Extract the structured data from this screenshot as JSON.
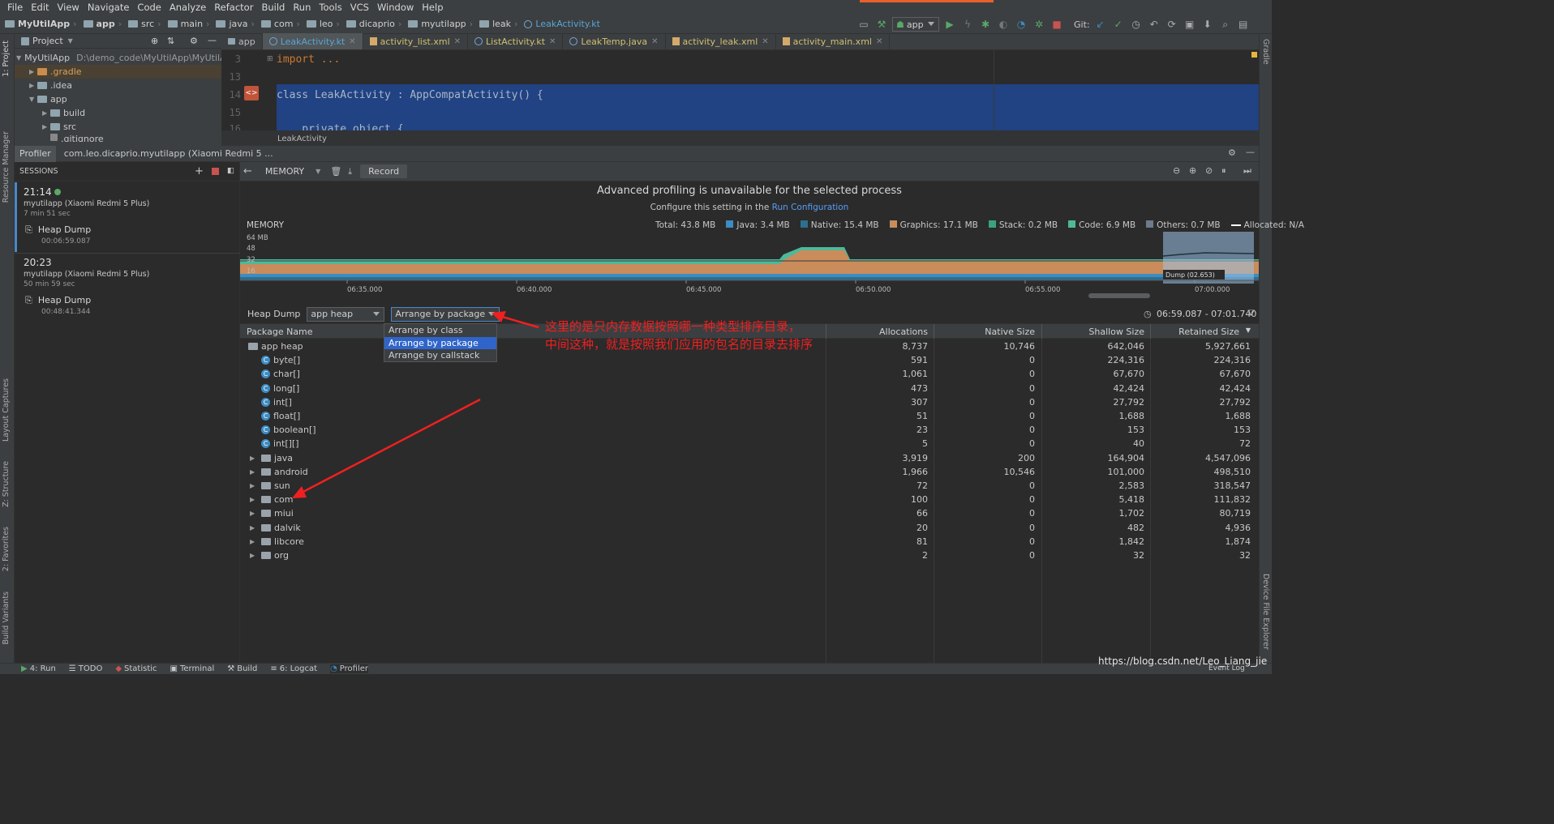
{
  "menu": [
    "File",
    "Edit",
    "View",
    "Navigate",
    "Code",
    "Analyze",
    "Refactor",
    "Build",
    "Run",
    "Tools",
    "VCS",
    "Window",
    "Help"
  ],
  "breadcrumbs": [
    "MyUtilApp",
    "app",
    "src",
    "main",
    "java",
    "com",
    "leo",
    "dicaprio",
    "myutilapp",
    "leak",
    "LeakActivity.kt"
  ],
  "toolbar": {
    "run_config": "app",
    "git_label": "Git:"
  },
  "project_panel": {
    "title": "Project",
    "tree": [
      {
        "label": "MyUtilApp",
        "path": "D:\\demo_code\\MyUtilApp\\MyUtilA",
        "depth": 0,
        "expanded": true
      },
      {
        "label": ".gradle",
        "depth": 1,
        "expanded": false
      },
      {
        "label": ".idea",
        "depth": 1,
        "expanded": false
      },
      {
        "label": "app",
        "depth": 1,
        "expanded": true
      },
      {
        "label": "build",
        "depth": 2,
        "expanded": false
      },
      {
        "label": "src",
        "depth": 2,
        "expanded": false
      },
      {
        "label": ".gitignore",
        "depth": 2
      }
    ]
  },
  "left_strip": [
    "1: Project",
    "Resource Manager",
    "Layout Captures",
    "Z: Structure",
    "2: Favorites",
    "Build Variants"
  ],
  "right_strip": [
    "Gradle",
    "Device File Explorer"
  ],
  "editor_tabs": [
    {
      "label": "app",
      "type": "folder"
    },
    {
      "label": "LeakActivity.kt",
      "type": "kt",
      "active": true
    },
    {
      "label": "activity_list.xml",
      "type": "xml"
    },
    {
      "label": "ListActivity.kt",
      "type": "kt"
    },
    {
      "label": "LeakTemp.java",
      "type": "java"
    },
    {
      "label": "activity_leak.xml",
      "type": "xml"
    },
    {
      "label": "activity_main.xml",
      "type": "xml"
    }
  ],
  "editor": {
    "lines": [
      {
        "num": "3",
        "text": "import ..."
      },
      {
        "num": "13",
        "text": ""
      },
      {
        "num": "14",
        "text": "class LeakActivity : AppCompatActivity() {"
      },
      {
        "num": "15",
        "text": ""
      },
      {
        "num": "16",
        "text": "    private object {"
      }
    ],
    "breadcrumb": "LeakActivity"
  },
  "profiler_header": {
    "tab": "Profiler",
    "process": "com.leo.dicaprio.myutilapp (Xiaomi Redmi 5 ..."
  },
  "sessions": {
    "title": "SESSIONS",
    "items": [
      {
        "time": "21:14",
        "device": "myutilapp (Xiaomi Redmi 5 Plus)",
        "duration": "7 min 51 sec",
        "dump": "Heap Dump",
        "dump_time": "00:06:59.087"
      },
      {
        "time": "20:23",
        "device": "myutilapp (Xiaomi Redmi 5 Plus)",
        "duration": "50 min 59 sec",
        "dump": "Heap Dump",
        "dump_time": "00:48:41.344"
      }
    ]
  },
  "memory_toolbar": {
    "mode": "MEMORY",
    "record": "Record"
  },
  "notice": {
    "title": "Advanced profiling is unavailable for the selected process",
    "sub": "Configure this setting in the ",
    "link": "Run Configuration"
  },
  "memory_chart": {
    "label": "MEMORY",
    "legend": [
      {
        "name": "Total: 43.8 MB",
        "color": ""
      },
      {
        "name": "Java: 3.4 MB",
        "color": "#3d8cc2"
      },
      {
        "name": "Native: 15.4 MB",
        "color": "#2e6e8e"
      },
      {
        "name": "Graphics: 17.1 MB",
        "color": "#c98c5a"
      },
      {
        "name": "Stack: 0.2 MB",
        "color": "#3aa37c"
      },
      {
        "name": "Code: 6.9 MB",
        "color": "#4fb89a"
      },
      {
        "name": "Others: 0.7 MB",
        "color": "#6d7c8a"
      },
      {
        "name": "Allocated: N/A",
        "color": "#ffffff"
      }
    ],
    "y_ticks": [
      "64 MB",
      "48",
      "32",
      "16"
    ],
    "x_ticks": [
      "06:35.000",
      "06:40.000",
      "06:45.000",
      "06:50.000",
      "06:55.000",
      "07:00.000"
    ],
    "dump_label": "Dump (02.653)"
  },
  "heap_bar": {
    "label": "Heap Dump",
    "heap": "app heap",
    "arrange": "Arrange by package",
    "range": "06:59.087 - 07:01.740"
  },
  "arrange_options": [
    "Arrange by class",
    "Arrange by package",
    "Arrange by callstack"
  ],
  "table": {
    "headers": [
      "Package Name",
      "Allocations",
      "Native Size",
      "Shallow Size",
      "Retained Size"
    ],
    "rows": [
      {
        "name": "app heap",
        "kind": "heap",
        "alloc": "8,737",
        "native": "10,746",
        "shallow": "642,046",
        "retained": "5,927,661"
      },
      {
        "name": "byte[]",
        "kind": "class",
        "alloc": "591",
        "native": "0",
        "shallow": "224,316",
        "retained": "224,316"
      },
      {
        "name": "char[]",
        "kind": "class",
        "alloc": "1,061",
        "native": "0",
        "shallow": "67,670",
        "retained": "67,670"
      },
      {
        "name": "long[]",
        "kind": "class",
        "alloc": "473",
        "native": "0",
        "shallow": "42,424",
        "retained": "42,424"
      },
      {
        "name": "int[]",
        "kind": "class",
        "alloc": "307",
        "native": "0",
        "shallow": "27,792",
        "retained": "27,792"
      },
      {
        "name": "float[]",
        "kind": "class",
        "alloc": "51",
        "native": "0",
        "shallow": "1,688",
        "retained": "1,688"
      },
      {
        "name": "boolean[]",
        "kind": "class",
        "alloc": "23",
        "native": "0",
        "shallow": "153",
        "retained": "153"
      },
      {
        "name": "int[][]",
        "kind": "class",
        "alloc": "5",
        "native": "0",
        "shallow": "40",
        "retained": "72"
      },
      {
        "name": "java",
        "kind": "pkg",
        "alloc": "3,919",
        "native": "200",
        "shallow": "164,904",
        "retained": "4,547,096"
      },
      {
        "name": "android",
        "kind": "pkg",
        "alloc": "1,966",
        "native": "10,546",
        "shallow": "101,000",
        "retained": "498,510"
      },
      {
        "name": "sun",
        "kind": "pkg",
        "alloc": "72",
        "native": "0",
        "shallow": "2,583",
        "retained": "318,547"
      },
      {
        "name": "com",
        "kind": "pkg",
        "alloc": "100",
        "native": "0",
        "shallow": "5,418",
        "retained": "111,832"
      },
      {
        "name": "miui",
        "kind": "pkg",
        "alloc": "66",
        "native": "0",
        "shallow": "1,702",
        "retained": "80,719"
      },
      {
        "name": "dalvik",
        "kind": "pkg",
        "alloc": "20",
        "native": "0",
        "shallow": "482",
        "retained": "4,936"
      },
      {
        "name": "libcore",
        "kind": "pkg",
        "alloc": "81",
        "native": "0",
        "shallow": "1,842",
        "retained": "1,874"
      },
      {
        "name": "org",
        "kind": "pkg",
        "alloc": "2",
        "native": "0",
        "shallow": "32",
        "retained": "32"
      }
    ]
  },
  "annotation": {
    "line1": "这里的是只内存数据按照哪一种类型排序目录，",
    "line2": "中间这种，就是按照我们应用的包名的目录去排序"
  },
  "bottom_tabs": [
    "4: Run",
    "TODO",
    "Statistic",
    "Terminal",
    "Build",
    "6: Logcat",
    "Profiler"
  ],
  "watermark": "https://blog.csdn.net/Leo_Liang_jie",
  "event_log": "Event Log"
}
